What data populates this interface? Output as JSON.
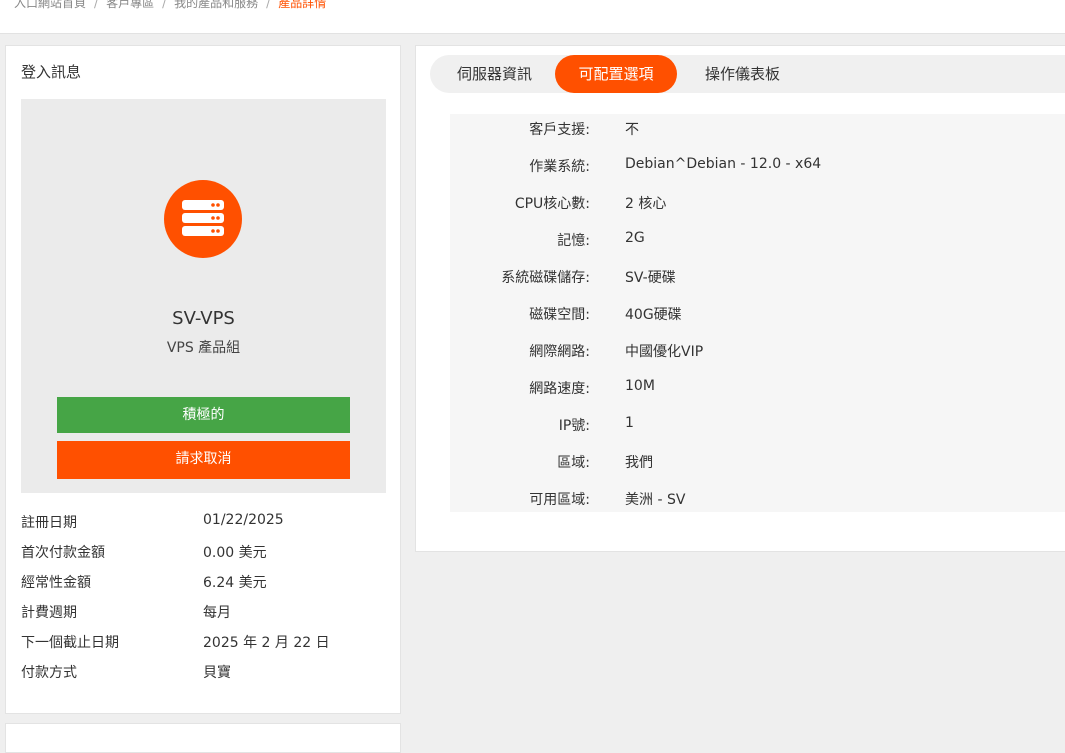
{
  "breadcrumb": {
    "items": [
      "入口網站首頁",
      "客戶專區",
      "我的產品和服務"
    ],
    "current": "產品詳情"
  },
  "login_panel": {
    "title": "登入訊息",
    "product_name": "SV-VPS",
    "product_group": "VPS 產品組",
    "status_label": "積極的",
    "cancel_label": "請求取消",
    "icon": "server-icon"
  },
  "details": [
    {
      "key": "註冊日期",
      "value": "01/22/2025"
    },
    {
      "key": "首次付款金額",
      "value": "0.00 美元"
    },
    {
      "key": "經常性金額",
      "value": "6.24 美元"
    },
    {
      "key": "計費週期",
      "value": "每月"
    },
    {
      "key": "下一個截止日期",
      "value": "2025 年 2 月 22 日"
    },
    {
      "key": "付款方式",
      "value": "貝寶"
    }
  ],
  "tabs": [
    {
      "label": "伺服器資訊",
      "active": false
    },
    {
      "label": "可配置選項",
      "active": true
    },
    {
      "label": "操作儀表板",
      "active": false
    }
  ],
  "options": [
    {
      "key": "客戶支援:",
      "value": "不"
    },
    {
      "key": "作業系統:",
      "value": "Debian^Debian - 12.0 - x64"
    },
    {
      "key": "CPU核心數:",
      "value": "2 核心"
    },
    {
      "key": "記憶:",
      "value": "2G"
    },
    {
      "key": "系統磁碟儲存:",
      "value": "SV-硬碟"
    },
    {
      "key": "磁碟空間:",
      "value": "40G硬碟"
    },
    {
      "key": "網際網路:",
      "value": "中國優化VIP"
    },
    {
      "key": "網路速度:",
      "value": "10M"
    },
    {
      "key": "IP號:",
      "value": "1"
    },
    {
      "key": "區域:",
      "value": "我們"
    },
    {
      "key": "可用區域:",
      "value": "美洲 - SV"
    }
  ],
  "colors": {
    "accent": "#ff5000",
    "active_green": "#46a546",
    "background": "#efefef"
  }
}
